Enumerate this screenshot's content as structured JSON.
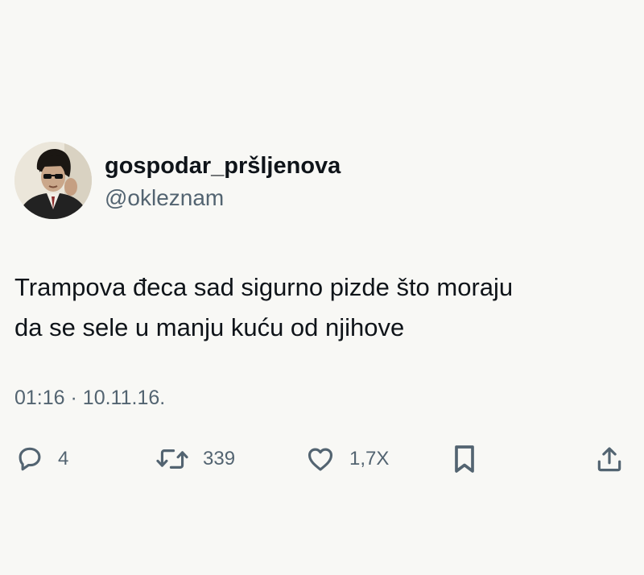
{
  "author": {
    "display_name": "gospodar_pršljenova",
    "handle": "@okleznam"
  },
  "tweet": {
    "lines": [
      "Trampova đeca sad sigurno pizde što moraju",
      "da se sele u manju kuću od njihove"
    ],
    "time": "01:16",
    "separator": "·",
    "date": "10.11.16."
  },
  "actions": {
    "replies": "4",
    "retweets": "339",
    "likes": "1,7X"
  },
  "icons": {
    "reply": "reply-icon",
    "retweet": "retweet-icon",
    "like": "heart-icon",
    "bookmark": "bookmark-icon",
    "share": "share-icon"
  },
  "colors": {
    "background": "#f8f8f5",
    "text": "#0f1419",
    "secondary": "#536471"
  }
}
